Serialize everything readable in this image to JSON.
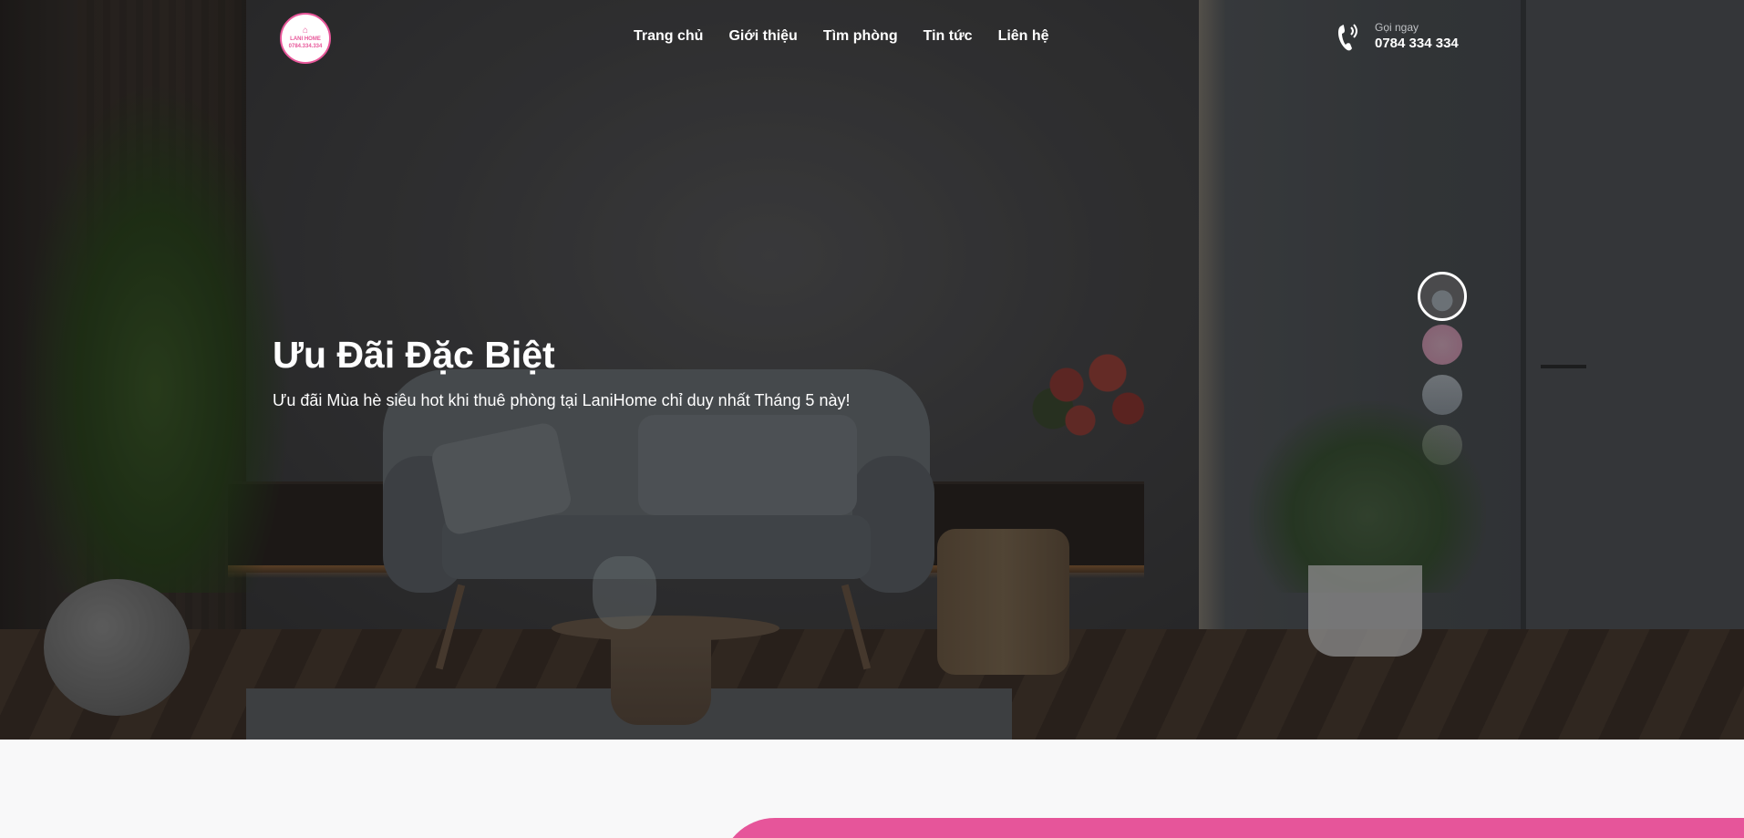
{
  "header": {
    "logo": {
      "label": "LANI HOME",
      "phone": "0784.334.334"
    },
    "nav": [
      {
        "label": "Trang chủ"
      },
      {
        "label": "Giới thiệu"
      },
      {
        "label": "Tìm phòng"
      },
      {
        "label": "Tin tức"
      },
      {
        "label": "Liên hệ"
      }
    ],
    "call": {
      "label": "Gọi ngay",
      "number": "0784 334 334"
    }
  },
  "hero": {
    "title": "Ưu Đãi Đặc Biệt",
    "subtitle": "Ưu đãi Mùa hè siêu hot khi thuê phòng tại LaniHome chỉ duy nhất Tháng 5 này!"
  },
  "slider": {
    "thumbnails": 4,
    "active_index": 0
  },
  "colors": {
    "accent": "#e6559a"
  }
}
